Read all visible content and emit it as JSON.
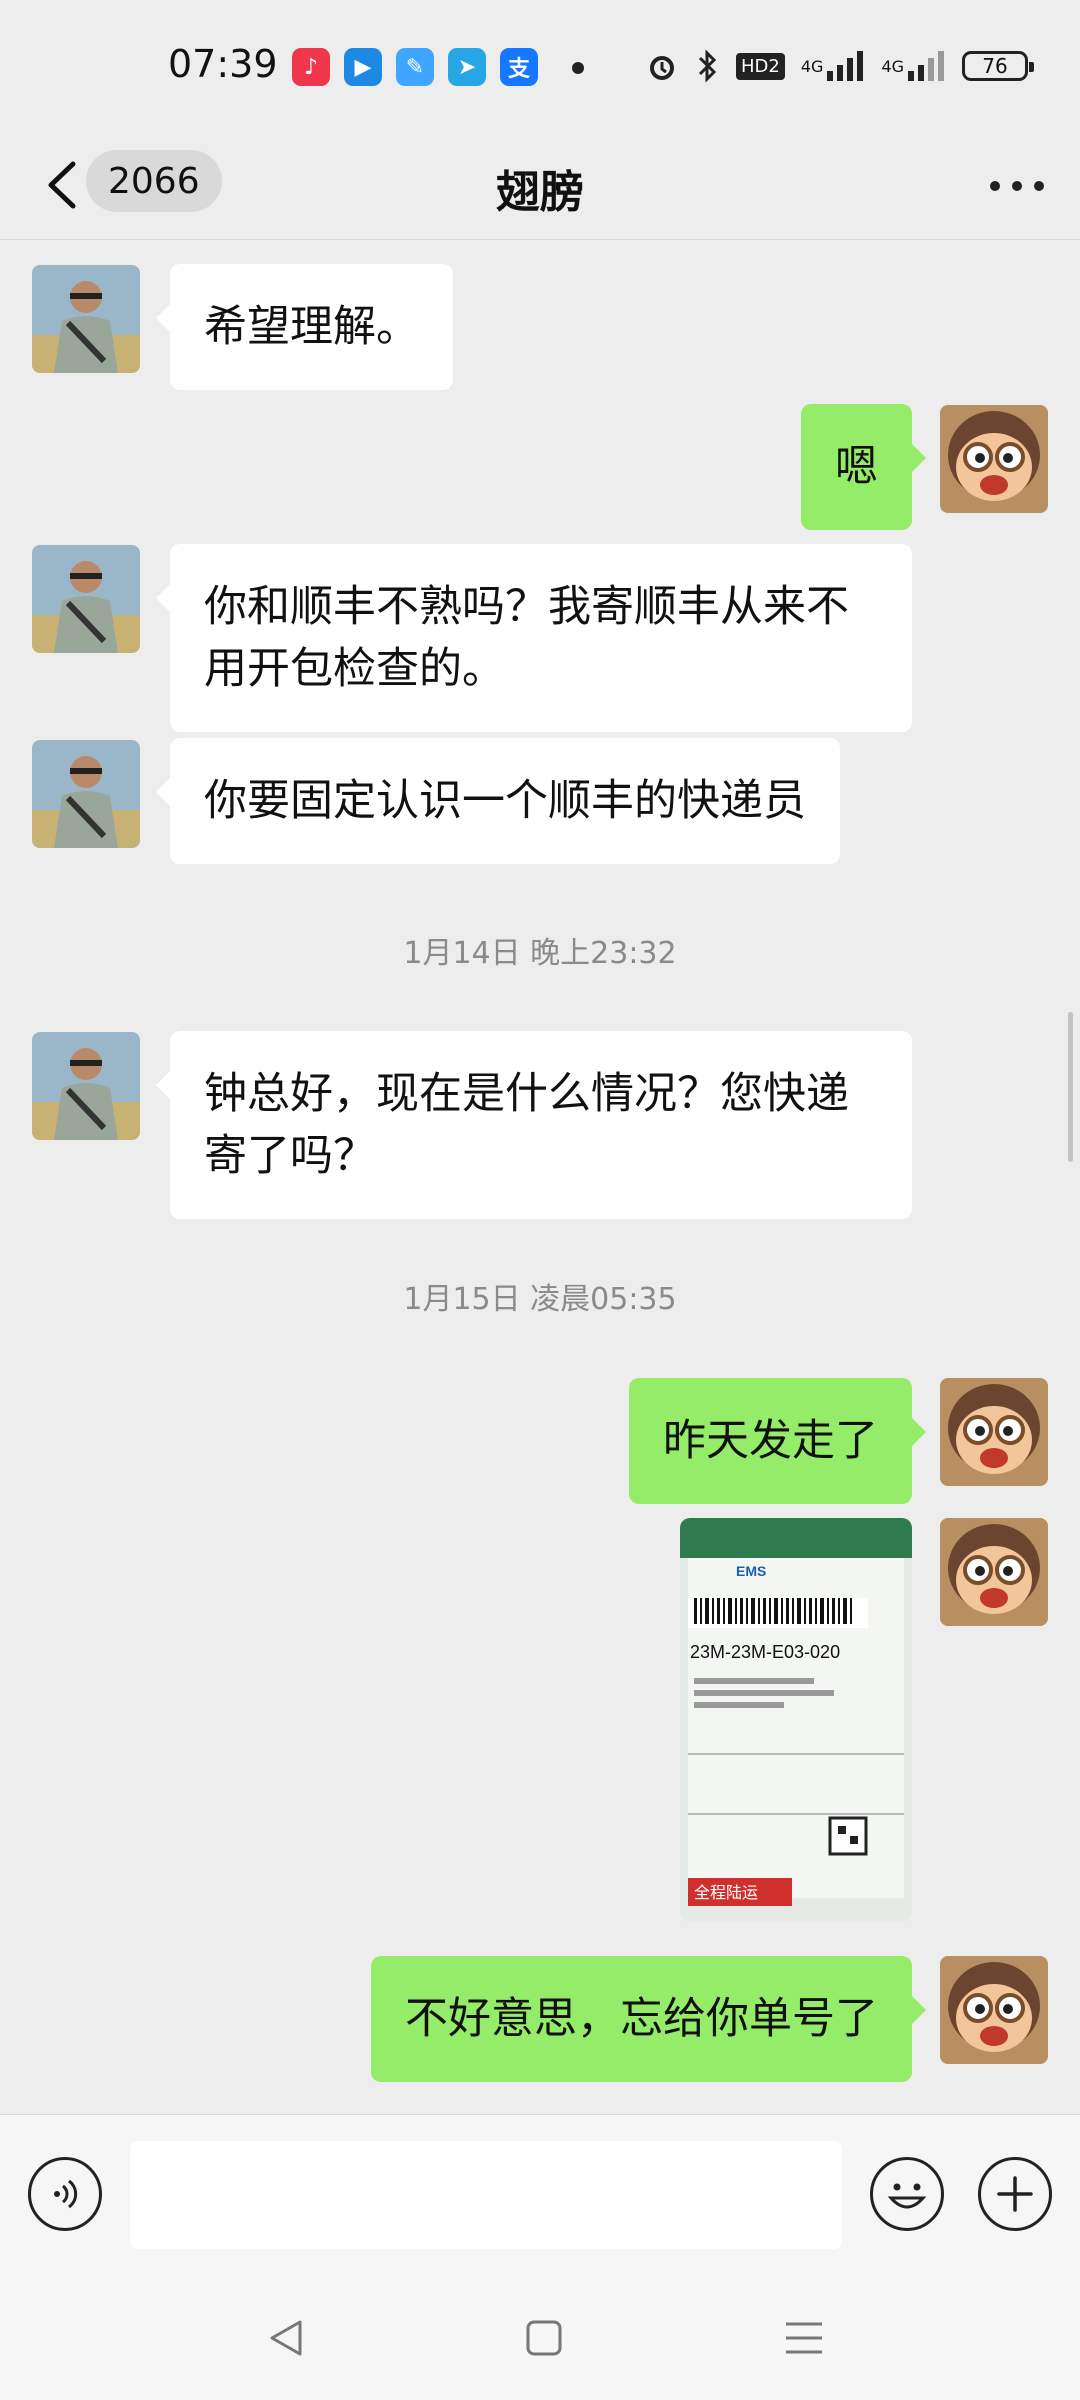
{
  "status_bar": {
    "time": "07:39",
    "app_icons": [
      {
        "name": "music-app-icon",
        "color": "#f0364a",
        "glyph": "♪"
      },
      {
        "name": "video-app-icon",
        "color": "#1e88e5",
        "glyph": "▶"
      },
      {
        "name": "notes-app-icon",
        "color": "#3ea6ff",
        "glyph": "✎"
      },
      {
        "name": "send-app-icon",
        "color": "#27a6e5",
        "glyph": "➤"
      },
      {
        "name": "alipay-app-icon",
        "color": "#1677ff",
        "glyph": "支"
      }
    ],
    "network_label": "HD2",
    "signal_1": "4G",
    "signal_2": "4G",
    "battery": "76"
  },
  "header": {
    "unread_count": "2066",
    "title": "翅膀"
  },
  "messages": [
    {
      "id": "m1",
      "side": "left",
      "text": "希望理解。"
    },
    {
      "id": "m2",
      "side": "right",
      "text": "嗯"
    },
    {
      "id": "m3",
      "side": "left",
      "line1": "你和顺丰不熟吗？我寄顺丰从来不",
      "line2": "用开包检查的。"
    },
    {
      "id": "m4",
      "side": "left",
      "text": "你要固定认识一个顺丰的快递员"
    },
    {
      "id": "ts1",
      "timestamp": "1月14日 晚上23:32"
    },
    {
      "id": "m5",
      "side": "left",
      "line1": "钟总好，现在是什么情况？您快递",
      "line2": "寄了吗？"
    },
    {
      "id": "ts2",
      "timestamp": "1月15日 凌晨05:35"
    },
    {
      "id": "m6",
      "side": "right",
      "text": "昨天发走了"
    },
    {
      "id": "m7",
      "side": "right",
      "type": "image",
      "label_code": "23M-23M-E03-020",
      "label_brand": "EMS",
      "label_tag": "全程陆运"
    },
    {
      "id": "m8",
      "side": "right",
      "text": "不好意思，忘给你单号了"
    }
  ],
  "colors": {
    "background": "#ededed",
    "bubble_self": "#95ec69",
    "bubble_other": "#ffffff"
  }
}
